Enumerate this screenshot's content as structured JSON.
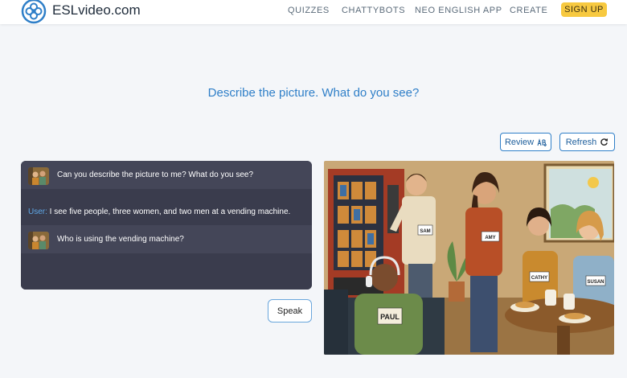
{
  "header": {
    "brand": "ESLvideo.com",
    "nav": [
      "QUIZZES",
      "CHATTYBOTS",
      "NEO ENGLISH APP",
      "CREATE"
    ],
    "signup": "SIGN UP"
  },
  "prompt": "Describe the picture. What do you see?",
  "buttons": {
    "review": "Review",
    "refresh": "Refresh",
    "speak": "Speak"
  },
  "chat": {
    "messages": [
      {
        "role": "bot",
        "text": "Can you describe the picture to me? What do you see?"
      },
      {
        "role": "user",
        "label": "User:",
        "text": " I see five people, three women, and two men at a vending machine."
      },
      {
        "role": "bot",
        "text": "Who is using the vending machine?"
      }
    ]
  },
  "picture": {
    "name_tags": [
      "SAM",
      "AMY",
      "CATHY",
      "SUSAN",
      "PAUL"
    ]
  },
  "colors": {
    "accent": "#2f7fc8",
    "signup": "#f7c940",
    "chat_bg": "#3a3c4d"
  }
}
